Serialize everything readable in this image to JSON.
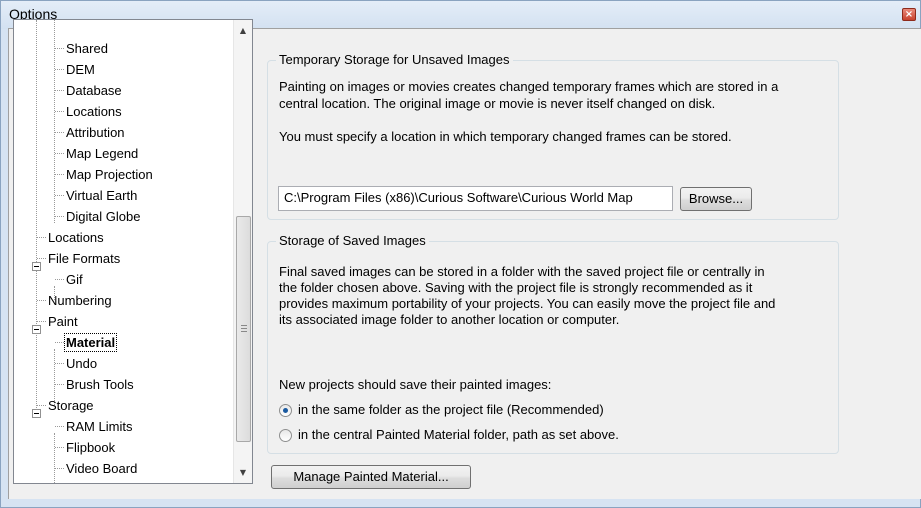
{
  "window": {
    "title": "Options",
    "close_glyph": "×"
  },
  "tree": {
    "items": [
      {
        "label": "Shared",
        "level": 2,
        "bold": false
      },
      {
        "label": "DEM",
        "level": 2,
        "bold": false
      },
      {
        "label": "Database",
        "level": 2,
        "bold": false
      },
      {
        "label": "Locations",
        "level": 2,
        "bold": false
      },
      {
        "label": "Attribution",
        "level": 2,
        "bold": false
      },
      {
        "label": "Map Legend",
        "level": 2,
        "bold": false
      },
      {
        "label": "Map Projection",
        "level": 2,
        "bold": false
      },
      {
        "label": "Virtual Earth",
        "level": 2,
        "bold": false
      },
      {
        "label": "Digital Globe",
        "level": 2,
        "bold": false
      },
      {
        "label": "Locations",
        "level": 1,
        "bold": false
      },
      {
        "label": "File Formats",
        "level": 1,
        "bold": false,
        "expanded": true
      },
      {
        "label": "Gif",
        "level": 2,
        "bold": false
      },
      {
        "label": "Numbering",
        "level": 1,
        "bold": false
      },
      {
        "label": "Paint",
        "level": 1,
        "bold": false,
        "expanded": true
      },
      {
        "label": "Material",
        "level": 2,
        "bold": true
      },
      {
        "label": "Undo",
        "level": 2,
        "bold": false
      },
      {
        "label": "Brush Tools",
        "level": 2,
        "bold": false
      },
      {
        "label": "Storage",
        "level": 1,
        "bold": false,
        "expanded": true
      },
      {
        "label": "RAM Limits",
        "level": 2,
        "bold": false
      },
      {
        "label": "Flipbook",
        "level": 2,
        "bold": false
      },
      {
        "label": "Video Board",
        "level": 2,
        "bold": false
      }
    ],
    "scroll_up_glyph": "▲",
    "scroll_down_glyph": "▼"
  },
  "temp_storage": {
    "title": "Temporary Storage for Unsaved Images",
    "line1": "Painting on images or movies creates changed temporary frames which are stored in a",
    "line2": "central location. The original image or movie is never itself changed on disk.",
    "line3": "You must specify a location in which temporary changed frames can be stored.",
    "path_value": "C:\\Program Files (x86)\\Curious Software\\Curious World Map",
    "browse_label": "Browse..."
  },
  "saved_storage": {
    "title": "Storage of Saved Images",
    "line1": "Final saved images can be stored in a folder with the saved project file or centrally in",
    "line2": "the folder chosen above. Saving with the project file is strongly recommended as it",
    "line3": "provides maximum portability of your projects. You can easily move the project file and",
    "line4": "its associated image folder to another location or computer.",
    "prompt": "New projects should save their painted images:",
    "option1": "in the same folder as the project file (Recommended)",
    "option2": "in the central Painted Material folder, path as set above."
  },
  "manage_button_label": "Manage Painted Material..."
}
